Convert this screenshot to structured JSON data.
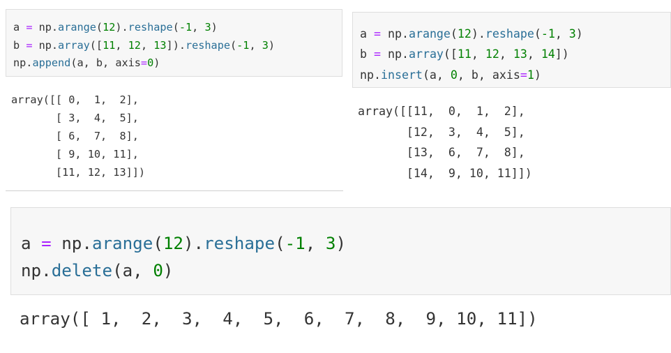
{
  "panel_append": {
    "code_lines": [
      [
        {
          "t": "a",
          "k": "var"
        },
        {
          "t": " ",
          "k": "pun"
        },
        {
          "t": "=",
          "k": "op"
        },
        {
          "t": " np.",
          "k": "var"
        },
        {
          "t": "arange",
          "k": "fn"
        },
        {
          "t": "(",
          "k": "pun"
        },
        {
          "t": "12",
          "k": "num"
        },
        {
          "t": ").",
          "k": "pun"
        },
        {
          "t": "reshape",
          "k": "fn"
        },
        {
          "t": "(",
          "k": "pun"
        },
        {
          "t": "-1",
          "k": "num"
        },
        {
          "t": ", ",
          "k": "pun"
        },
        {
          "t": "3",
          "k": "num"
        },
        {
          "t": ")",
          "k": "pun"
        }
      ],
      [
        {
          "t": "b",
          "k": "var"
        },
        {
          "t": " ",
          "k": "pun"
        },
        {
          "t": "=",
          "k": "op"
        },
        {
          "t": " np.",
          "k": "var"
        },
        {
          "t": "array",
          "k": "fn"
        },
        {
          "t": "([",
          "k": "pun"
        },
        {
          "t": "11",
          "k": "num"
        },
        {
          "t": ", ",
          "k": "pun"
        },
        {
          "t": "12",
          "k": "num"
        },
        {
          "t": ", ",
          "k": "pun"
        },
        {
          "t": "13",
          "k": "num"
        },
        {
          "t": "]).",
          "k": "pun"
        },
        {
          "t": "reshape",
          "k": "fn"
        },
        {
          "t": "(",
          "k": "pun"
        },
        {
          "t": "-1",
          "k": "num"
        },
        {
          "t": ", ",
          "k": "pun"
        },
        {
          "t": "3",
          "k": "num"
        },
        {
          "t": ")",
          "k": "pun"
        }
      ],
      [
        {
          "t": "np.",
          "k": "var"
        },
        {
          "t": "append",
          "k": "fn"
        },
        {
          "t": "(a, b, axis",
          "k": "pun"
        },
        {
          "t": "=",
          "k": "op"
        },
        {
          "t": "0",
          "k": "num"
        },
        {
          "t": ")",
          "k": "pun"
        }
      ]
    ],
    "output_lines": [
      "array([[ 0,  1,  2],",
      "       [ 3,  4,  5],",
      "       [ 6,  7,  8],",
      "       [ 9, 10, 11],",
      "       [11, 12, 13]])"
    ]
  },
  "panel_insert": {
    "code_lines": [
      [
        {
          "t": "a",
          "k": "var"
        },
        {
          "t": " ",
          "k": "pun"
        },
        {
          "t": "=",
          "k": "op"
        },
        {
          "t": " np.",
          "k": "var"
        },
        {
          "t": "arange",
          "k": "fn"
        },
        {
          "t": "(",
          "k": "pun"
        },
        {
          "t": "12",
          "k": "num"
        },
        {
          "t": ").",
          "k": "pun"
        },
        {
          "t": "reshape",
          "k": "fn"
        },
        {
          "t": "(",
          "k": "pun"
        },
        {
          "t": "-1",
          "k": "num"
        },
        {
          "t": ", ",
          "k": "pun"
        },
        {
          "t": "3",
          "k": "num"
        },
        {
          "t": ")",
          "k": "pun"
        }
      ],
      [
        {
          "t": "b",
          "k": "var"
        },
        {
          "t": " ",
          "k": "pun"
        },
        {
          "t": "=",
          "k": "op"
        },
        {
          "t": " np.",
          "k": "var"
        },
        {
          "t": "array",
          "k": "fn"
        },
        {
          "t": "([",
          "k": "pun"
        },
        {
          "t": "11",
          "k": "num"
        },
        {
          "t": ", ",
          "k": "pun"
        },
        {
          "t": "12",
          "k": "num"
        },
        {
          "t": ", ",
          "k": "pun"
        },
        {
          "t": "13",
          "k": "num"
        },
        {
          "t": ", ",
          "k": "pun"
        },
        {
          "t": "14",
          "k": "num"
        },
        {
          "t": "])",
          "k": "pun"
        }
      ],
      [
        {
          "t": "np.",
          "k": "var"
        },
        {
          "t": "insert",
          "k": "fn"
        },
        {
          "t": "(a, ",
          "k": "pun"
        },
        {
          "t": "0",
          "k": "num"
        },
        {
          "t": ", b, axis",
          "k": "pun"
        },
        {
          "t": "=",
          "k": "op"
        },
        {
          "t": "1",
          "k": "num"
        },
        {
          "t": ")",
          "k": "pun"
        }
      ]
    ],
    "output_lines": [
      "array([[11,  0,  1,  2],",
      "       [12,  3,  4,  5],",
      "       [13,  6,  7,  8],",
      "       [14,  9, 10, 11]])"
    ]
  },
  "panel_delete": {
    "code_lines": [
      [
        {
          "t": "a",
          "k": "var"
        },
        {
          "t": " ",
          "k": "pun"
        },
        {
          "t": "=",
          "k": "op"
        },
        {
          "t": " np.",
          "k": "var"
        },
        {
          "t": "arange",
          "k": "fn"
        },
        {
          "t": "(",
          "k": "pun"
        },
        {
          "t": "12",
          "k": "num"
        },
        {
          "t": ").",
          "k": "pun"
        },
        {
          "t": "reshape",
          "k": "fn"
        },
        {
          "t": "(",
          "k": "pun"
        },
        {
          "t": "-1",
          "k": "num"
        },
        {
          "t": ", ",
          "k": "pun"
        },
        {
          "t": "3",
          "k": "num"
        },
        {
          "t": ")",
          "k": "pun"
        }
      ],
      [
        {
          "t": "np.",
          "k": "var"
        },
        {
          "t": "delete",
          "k": "fn"
        },
        {
          "t": "(a, ",
          "k": "pun"
        },
        {
          "t": "0",
          "k": "num"
        },
        {
          "t": ")",
          "k": "pun"
        }
      ]
    ],
    "output_lines": [
      "array([ 1,  2,  3,  4,  5,  6,  7,  8,  9, 10, 11])"
    ]
  },
  "colors": {
    "cell_background": "#f7f7f7",
    "function": "#2a6f97",
    "number": "#008000",
    "operator": "#aa22ff",
    "text": "#333333"
  }
}
